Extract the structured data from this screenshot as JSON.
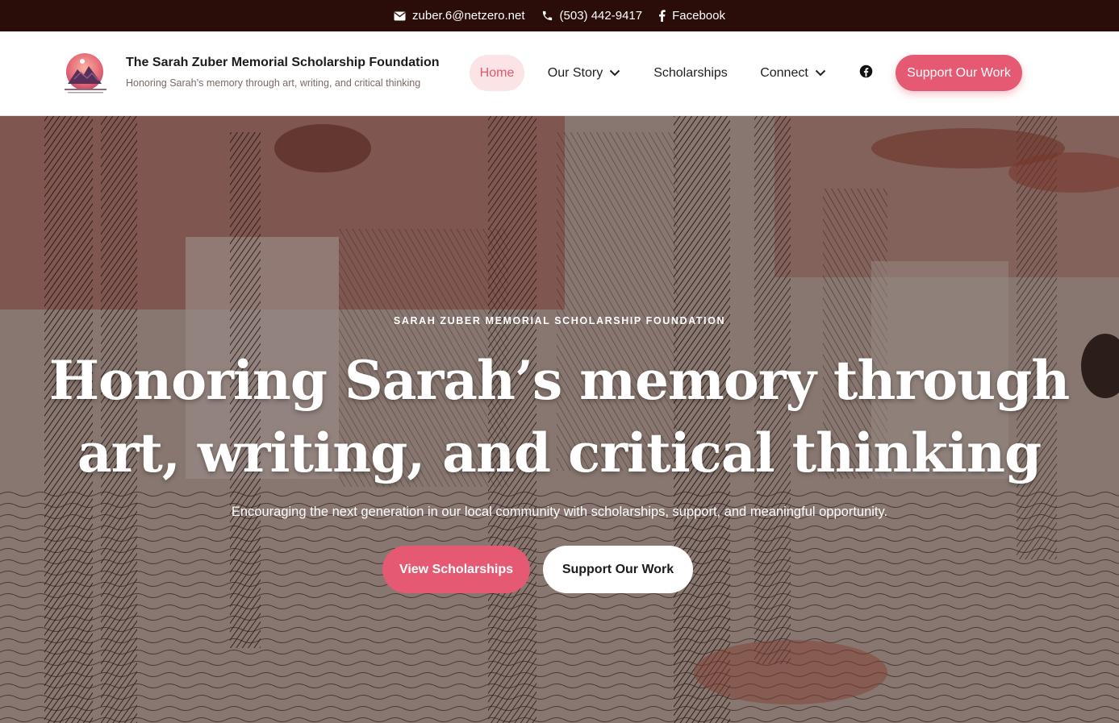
{
  "topbar": {
    "email": "zuber.6@netzero.net",
    "phone": "(503) 442-9417",
    "facebook": "Facebook"
  },
  "header": {
    "brand_title": "The Sarah Zuber Memorial Scholarship Foundation",
    "brand_tagline": "Honoring Sarah’s memory through art, writing, and critical thinking",
    "nav": {
      "home": "Home",
      "our_story": "Our Story",
      "scholarships": "Scholarships",
      "connect": "Connect",
      "support": "Support Our Work"
    }
  },
  "hero": {
    "eyebrow": "SARAH ZUBER MEMORIAL SCHOLARSHIP FOUNDATION",
    "title_line1": "Honoring Sarah’s memory through",
    "title_line2": "art, writing, and critical thinking",
    "subtitle": "Encouraging the next generation in our local community with scholarships, support, and meaningful opportunity.",
    "primary_button": "View Scholarships",
    "secondary_button": "Support Our Work"
  },
  "colors": {
    "accent": "#e55a72",
    "topbar": "#2a0d09",
    "home_pill": "#fbe3e6"
  },
  "icons": {
    "email": "envelope-icon",
    "phone": "phone-icon",
    "facebook": "facebook-icon",
    "dropdown": "chevron-down-icon"
  }
}
